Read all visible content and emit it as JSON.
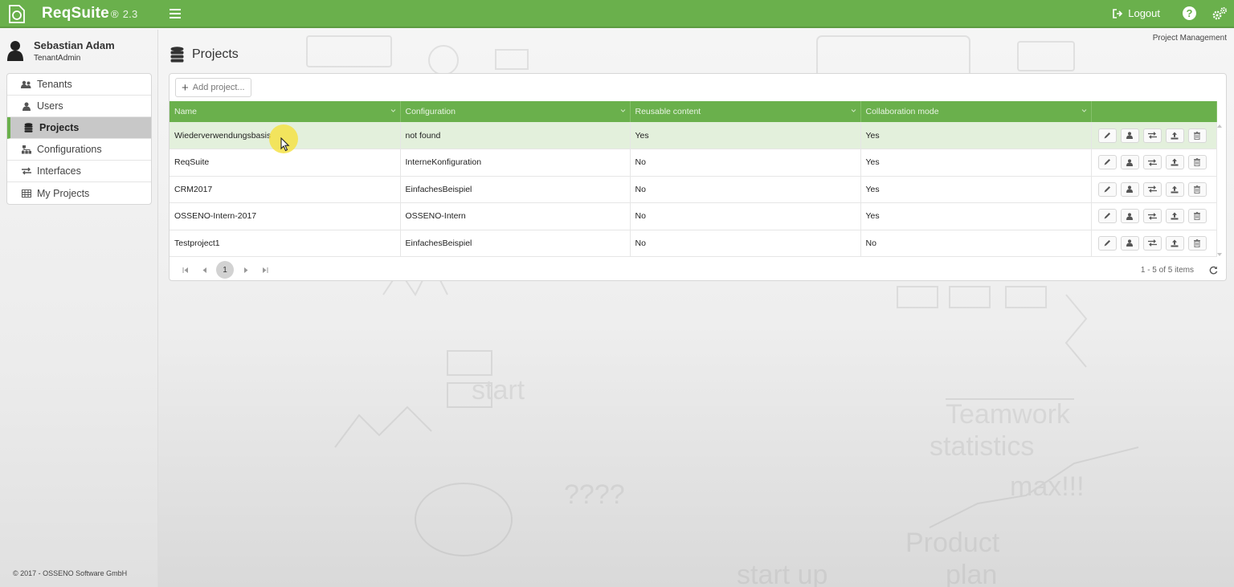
{
  "app": {
    "name": "ReqSuite",
    "reg": "®",
    "version": "2.3"
  },
  "topbar": {
    "logout_label": "Logout",
    "help_label": "?"
  },
  "user": {
    "name": "Sebastian Adam",
    "role": "TenantAdmin"
  },
  "sidebar": {
    "items": [
      {
        "label": "Tenants",
        "icon": "users-icon",
        "active": false
      },
      {
        "label": "Users",
        "icon": "user-icon",
        "active": false
      },
      {
        "label": "Projects",
        "icon": "database-icon",
        "active": true
      },
      {
        "label": "Configurations",
        "icon": "sitemap-icon",
        "active": false
      },
      {
        "label": "Interfaces",
        "icon": "exchange-icon",
        "active": false
      },
      {
        "label": "My Projects",
        "icon": "table-icon",
        "active": false
      }
    ]
  },
  "footer": {
    "copyright": "© 2017 - OSSENO Software GmbH"
  },
  "header": {
    "section": "Project Management",
    "title": "Projects"
  },
  "toolbar": {
    "add_label": "Add project..."
  },
  "grid": {
    "columns": [
      "Name",
      "Configuration",
      "Reusable content",
      "Collaboration mode"
    ],
    "rows": [
      {
        "name": "Wiederverwendungsbasis",
        "configuration": "not found",
        "reusable": "Yes",
        "collaboration": "Yes",
        "selected": true
      },
      {
        "name": "ReqSuite",
        "configuration": "InterneKonfiguration",
        "reusable": "No",
        "collaboration": "Yes",
        "selected": false
      },
      {
        "name": "CRM2017",
        "configuration": "EinfachesBeispiel",
        "reusable": "No",
        "collaboration": "Yes",
        "selected": false
      },
      {
        "name": "OSSENO-Intern-2017",
        "configuration": "OSSENO-Intern",
        "reusable": "No",
        "collaboration": "Yes",
        "selected": false
      },
      {
        "name": "Testproject1",
        "configuration": "EinfachesBeispiel",
        "reusable": "No",
        "collaboration": "No",
        "selected": false
      }
    ],
    "row_actions": [
      "edit-icon",
      "user-icon",
      "exchange-icon",
      "upload-icon",
      "trash-icon"
    ]
  },
  "pager": {
    "current_page": "1",
    "info": "1 - 5 of 5 items"
  },
  "colors": {
    "accent": "#6ab04c",
    "selected_row": "#e3f0dc",
    "active_nav": "#c8c8c8"
  }
}
